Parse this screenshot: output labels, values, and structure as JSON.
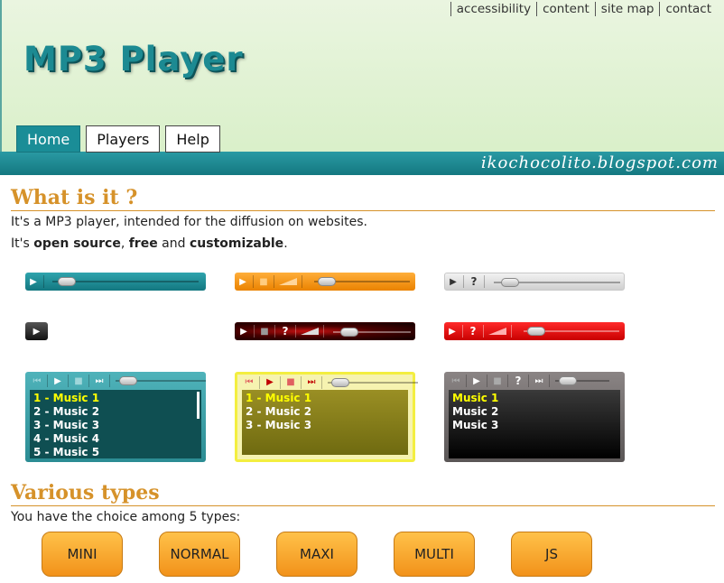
{
  "topnav": [
    "accessibility",
    "content",
    "site map",
    "contact"
  ],
  "logo": "MP3 Player",
  "tabs": [
    "Home",
    "Players",
    "Help"
  ],
  "watermark": "ikochocolito.blogspot.com",
  "section1": {
    "title": "What is it ?",
    "line1": "It's a MP3 player, intended for the diffusion on websites.",
    "line2_prefix": "It's ",
    "line2_b1": "open source",
    "line2_sep1": ", ",
    "line2_b2": "free",
    "line2_sep2": " and ",
    "line2_b3": "customizable",
    "line2_suffix": "."
  },
  "playlists": {
    "teal": [
      "1 - Music 1",
      "2 - Music 2",
      "3 - Music 3",
      "4 - Music 4",
      "5 - Music 5"
    ],
    "yellow": [
      "1 - Music 1",
      "2 - Music 2",
      "3 - Music 3"
    ],
    "black": [
      "Music 1",
      "Music 2",
      "Music 3"
    ]
  },
  "icons": {
    "play": "▶",
    "stop": "■",
    "next": "⏭",
    "prev": "⏮",
    "help": "?"
  },
  "section2": {
    "title": "Various types",
    "intro": "You have the choice among 5 types:"
  },
  "types": [
    "MINI",
    "NORMAL",
    "MAXI",
    "MULTI",
    "JS"
  ],
  "colors": {
    "teal": "#1a8d97",
    "orange": "#f2921a",
    "gold": "#d6922a",
    "red": "#e01010"
  }
}
